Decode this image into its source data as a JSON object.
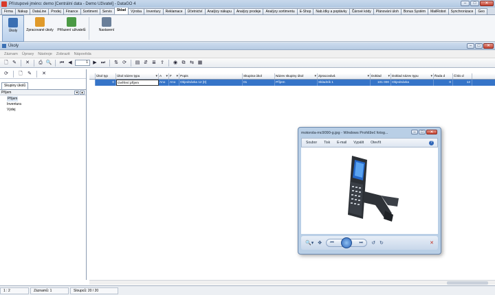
{
  "app": {
    "title": "Přístupové jméno: demo [Centrální data - Demo Uživatel] - DataGO 4",
    "window_controls": {
      "minimize": "–",
      "maximize": "□",
      "close": "✕"
    }
  },
  "modules": [
    "Firma",
    "Nákup",
    "DataLine",
    "Prodej",
    "Finance",
    "Sortiment",
    "Servis",
    "Sklad",
    "Výroba",
    "Inventury",
    "Reklamace",
    "Účetnictví",
    "Analýzy nákupu",
    "Analýzy prodeje",
    "Analýzy sortimentu",
    "E-Shop",
    "Nab.ídky a poptávky",
    "Čárové kódy",
    "Plánování úloh",
    "Bonus Systém",
    "MailRobot",
    "Synchronizace",
    "Geo"
  ],
  "active_module": "Sklad",
  "ribbon": [
    {
      "label": "Úkoly",
      "icon": "tasks-icon",
      "color": "#3a6fb3"
    },
    {
      "label": "Zpracované úkoly",
      "icon": "done-tasks-icon",
      "color": "#e09a2a"
    },
    {
      "label": "Přiřazení uživatelů",
      "icon": "users-icon",
      "color": "#4b9a45"
    },
    {
      "label": "Nastavení",
      "icon": "settings-icon",
      "color": "#6a7f99"
    }
  ],
  "inner": {
    "title": "Úkoly",
    "menu": [
      "Záznam",
      "Úpravy",
      "Nástroje",
      "Zobrazit",
      "Nápověda"
    ],
    "page_value": "1",
    "toolbar_glyphs": {
      "new": "🗋",
      "edit": "✎",
      "delete": "✕",
      "print": "⎙",
      "preview": "🔍",
      "first": "⏮",
      "prev": "◀",
      "next": "▶",
      "last": "⏭",
      "filter": "⇅",
      "refresh": "⟳",
      "chart": "▤",
      "sort": "⇵",
      "group": "≣",
      "export": "⇪",
      "view": "◉",
      "copy": "⧉",
      "move": "⇆",
      "calc": "▦"
    }
  },
  "left_panel": {
    "toolbar_glyphs": {
      "refresh": "⟳",
      "new": "🗋",
      "edit": "✎",
      "delete": "✕"
    },
    "tab": "Skupiny úkolů",
    "header": "Příjem",
    "arrow_left": "◂",
    "arrow_up": "▴",
    "tree": [
      "Příjem",
      "Inventura",
      "Výdej"
    ]
  },
  "grid": {
    "columns": [
      "Úkol typ",
      "Úkol název typu",
      "A",
      "F",
      "Popis",
      "Skupina úkol",
      "Název skupiny úkol",
      "Zpracovává",
      "Doklad",
      "Doklad název typu",
      "Řada d",
      "Číslo d"
    ],
    "rows": [
      [
        "0",
        "Ověření příjem",
        "Ano",
        "Ano",
        "Objednávka 12 [0]",
        "01",
        "Příjem",
        "Skladník 1",
        "101 000",
        "Objednávka",
        "0",
        "12"
      ]
    ]
  },
  "status": {
    "position": "1 : 2",
    "records": "Záznamů: 1",
    "columns": "Sloupců: 20 / 20"
  },
  "viewer": {
    "title": "motorola-mc9090-g.jpg - Windows Prohlížeč fotog...",
    "menu": [
      "Soubor",
      "Tisk",
      "E-mail",
      "Vypálit",
      "Otevřít"
    ],
    "help": "?",
    "controls": {
      "zoom": "🔍▾",
      "fit": "✥",
      "prev": "⏮",
      "next": "⏭",
      "rotate_left": "↺",
      "rotate_right": "↻",
      "delete": "✕"
    }
  }
}
